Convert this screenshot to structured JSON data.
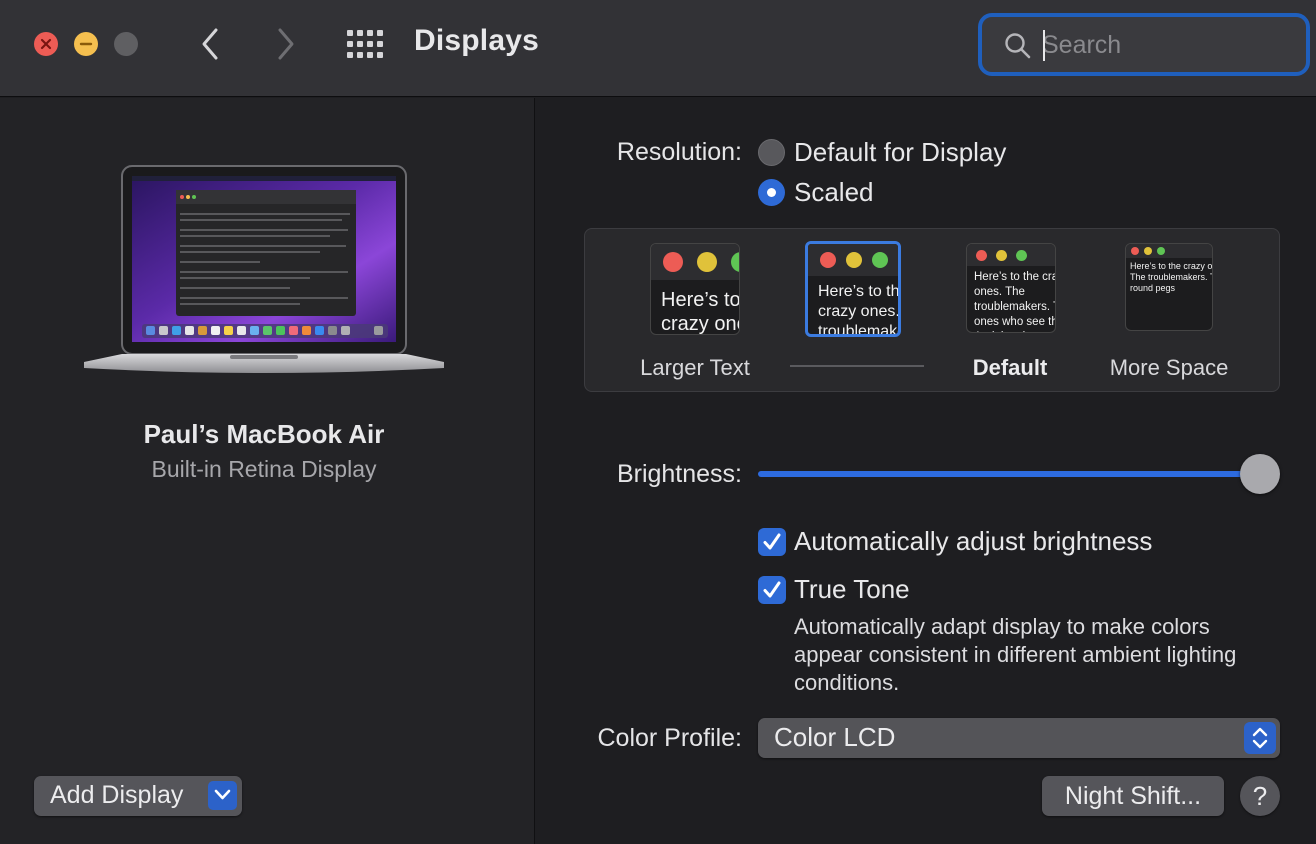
{
  "window": {
    "title": "Displays",
    "search_placeholder": "Search"
  },
  "sidebar": {
    "display_name": "Paul’s MacBook Air",
    "display_type": "Built-in Retina Display",
    "add_display_label": "Add Display"
  },
  "resolution": {
    "label": "Resolution:",
    "options": [
      {
        "label": "Default for Display",
        "selected": false
      },
      {
        "label": "Scaled",
        "selected": true
      }
    ],
    "scale_options": [
      {
        "label": "Larger Text",
        "preview_text": "Here’s to the crazy ones. The troublemakers.",
        "selected": false
      },
      {
        "label": "",
        "preview_text": "Here’s to the crazy ones. The troublemakers, the ones who",
        "selected": true
      },
      {
        "label": "Default",
        "preview_text": "Here’s to the crazy ones. The troublemakers. The ones who see things. And they have",
        "selected": false
      },
      {
        "label": "More Space",
        "preview_text": "Here’s to the crazy ones. The troublemakers. The round pegs",
        "selected": false
      }
    ]
  },
  "brightness": {
    "label": "Brightness:",
    "value": 1.0,
    "auto_adjust_label": "Automatically adjust brightness",
    "auto_adjust_checked": true,
    "true_tone_label": "True Tone",
    "true_tone_checked": true,
    "true_tone_description": "Automatically adapt display to make colors appear consistent in different ambient lighting conditions."
  },
  "color_profile": {
    "label": "Color Profile:",
    "value": "Color LCD"
  },
  "footer": {
    "night_shift_label": "Night Shift...",
    "help_label": "?"
  },
  "colors": {
    "accent": "#2e6ad6",
    "close": "#ed5c55",
    "minimize": "#f5bf4f"
  }
}
